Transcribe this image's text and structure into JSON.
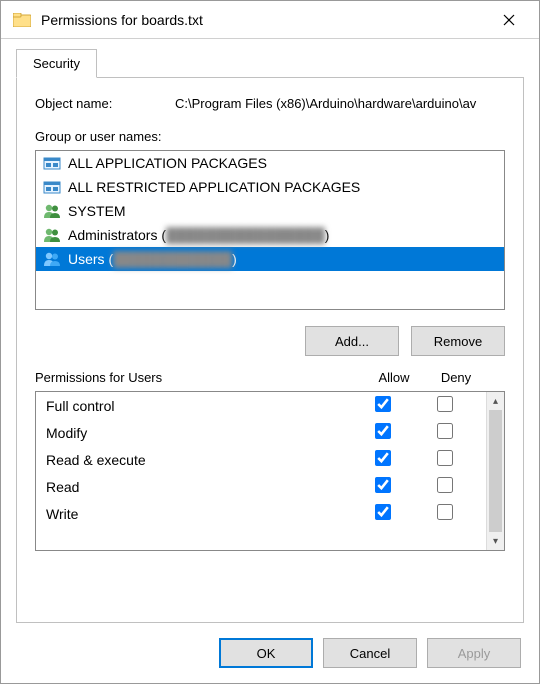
{
  "window": {
    "title": "Permissions for boards.txt"
  },
  "tab": {
    "label": "Security"
  },
  "objectName": {
    "label": "Object name:",
    "value": "C:\\Program Files (x86)\\Arduino\\hardware\\arduino\\av"
  },
  "groupsLabel": "Group or user names:",
  "principals": [
    {
      "icon": "package",
      "name": "ALL APPLICATION PACKAGES",
      "obscured": "",
      "selected": false
    },
    {
      "icon": "package",
      "name": "ALL RESTRICTED APPLICATION PACKAGES",
      "obscured": "",
      "selected": false
    },
    {
      "icon": "users",
      "name": "SYSTEM",
      "obscured": "",
      "selected": false
    },
    {
      "icon": "users",
      "name": "Administrators (",
      "obscured": "████████████████",
      "trail": ")",
      "selected": false
    },
    {
      "icon": "users",
      "name": "Users (",
      "obscured": "████████████",
      "trail": ")",
      "selected": true
    }
  ],
  "buttons": {
    "add": "Add...",
    "remove": "Remove",
    "ok": "OK",
    "cancel": "Cancel",
    "apply": "Apply"
  },
  "permHeader": {
    "label": "Permissions for Users",
    "allow": "Allow",
    "deny": "Deny"
  },
  "permissions": [
    {
      "name": "Full control",
      "allow": true,
      "deny": false
    },
    {
      "name": "Modify",
      "allow": true,
      "deny": false
    },
    {
      "name": "Read & execute",
      "allow": true,
      "deny": false
    },
    {
      "name": "Read",
      "allow": true,
      "deny": false
    },
    {
      "name": "Write",
      "allow": true,
      "deny": false
    }
  ]
}
